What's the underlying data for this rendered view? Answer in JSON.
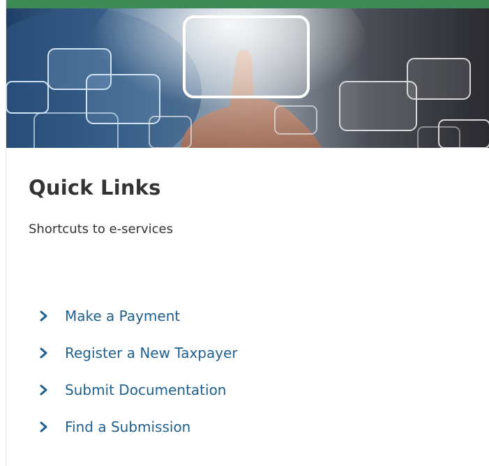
{
  "header": {
    "accent_color": "#3e8a57",
    "banner_image": "hand-touching-screen-banner"
  },
  "quick_links": {
    "title": "Quick Links",
    "subtitle": "Shortcuts to e-services",
    "link_color": "#1e5f8f",
    "items": [
      {
        "label": "Make a Payment",
        "icon": "chevron-right-icon"
      },
      {
        "label": "Register a New Taxpayer",
        "icon": "chevron-right-icon"
      },
      {
        "label": "Submit Documentation",
        "icon": "chevron-right-icon"
      },
      {
        "label": "Find a Submission",
        "icon": "chevron-right-icon"
      }
    ]
  }
}
